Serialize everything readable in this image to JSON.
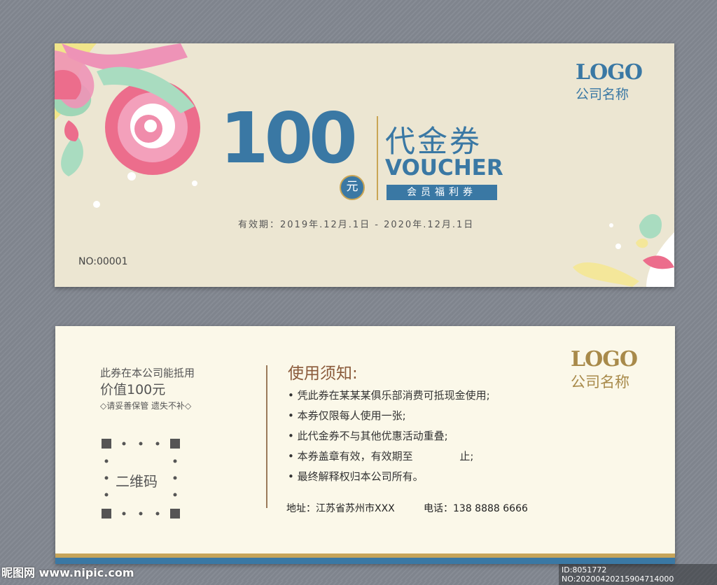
{
  "front": {
    "amount": "100",
    "currency_unit": "元",
    "title_cn": "代金券",
    "title_en": "VOUCHER",
    "member_badge": "会员福利券",
    "validity": "有效期：2019年.12月.1日 - 2020年.12月.1日",
    "serial": "NO:00001",
    "logo_text": "LOGO",
    "company_name": "公司名称"
  },
  "back": {
    "usage_line1": "此券在本公司能抵用",
    "usage_line2": "价值100元",
    "keep_note": "◇请妥善保管 遗失不补◇",
    "qr_label": "二维码",
    "notice_title": "使用须知:",
    "rules": [
      "凭此券在某某某俱乐部消费可抵现金使用;",
      "本券仅限每人使用一张;",
      "此代金券不与其他优惠活动重叠;",
      "本券盖章有效，有效期至              止;",
      "最终解释权归本公司所有。"
    ],
    "address": "地址：江苏省苏州市XXX",
    "phone": "电话：138 8888 6666",
    "logo_text": "LOGO",
    "company_name": "公司名称"
  },
  "watermark": {
    "site": "昵图网 www.nipic.com",
    "id": "ID:8051772 NO:20200420215904714000"
  },
  "colors": {
    "primary_blue": "#3a78a4",
    "gold": "#c6a45a",
    "front_bg": "#ece6d2",
    "back_bg": "#fbf8e9"
  },
  "icons": [
    "swirl-decoration",
    "splash-decoration",
    "qr-placeholder-icon"
  ]
}
